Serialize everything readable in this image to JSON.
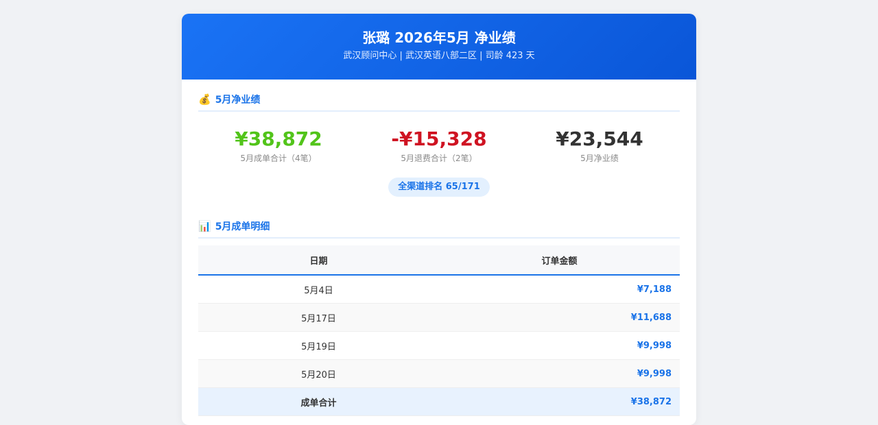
{
  "header": {
    "title": "张璐 2026年5月 净业绩",
    "subtitle": "武汉顾问中心 | 武汉英语八部二区 | 司龄 423 天"
  },
  "summary": {
    "icon": "money-bag-icon",
    "emoji": "💰",
    "title": "5月净业绩",
    "stats": [
      {
        "value": "¥38,872",
        "label": "5月成单合计（4笔）",
        "color": "#52c41a"
      },
      {
        "value": "-¥15,328",
        "label": "5月退费合计（2笔）",
        "color": "#cf1322"
      },
      {
        "value": "¥23,544",
        "label": "5月净业绩",
        "color": "#333333"
      }
    ],
    "rank": "全渠道排名 65/171"
  },
  "details": {
    "icon": "bar-chart-icon",
    "emoji": "📊",
    "title": "5月成单明细",
    "columns": [
      "日期",
      "订单金额"
    ],
    "rows": [
      {
        "date": "5月4日",
        "amount": "¥7,188"
      },
      {
        "date": "5月17日",
        "amount": "¥11,688"
      },
      {
        "date": "5月19日",
        "amount": "¥9,998"
      },
      {
        "date": "5月20日",
        "amount": "¥9,998"
      }
    ],
    "total_label": "成单合计",
    "total_amount": "¥38,872"
  }
}
